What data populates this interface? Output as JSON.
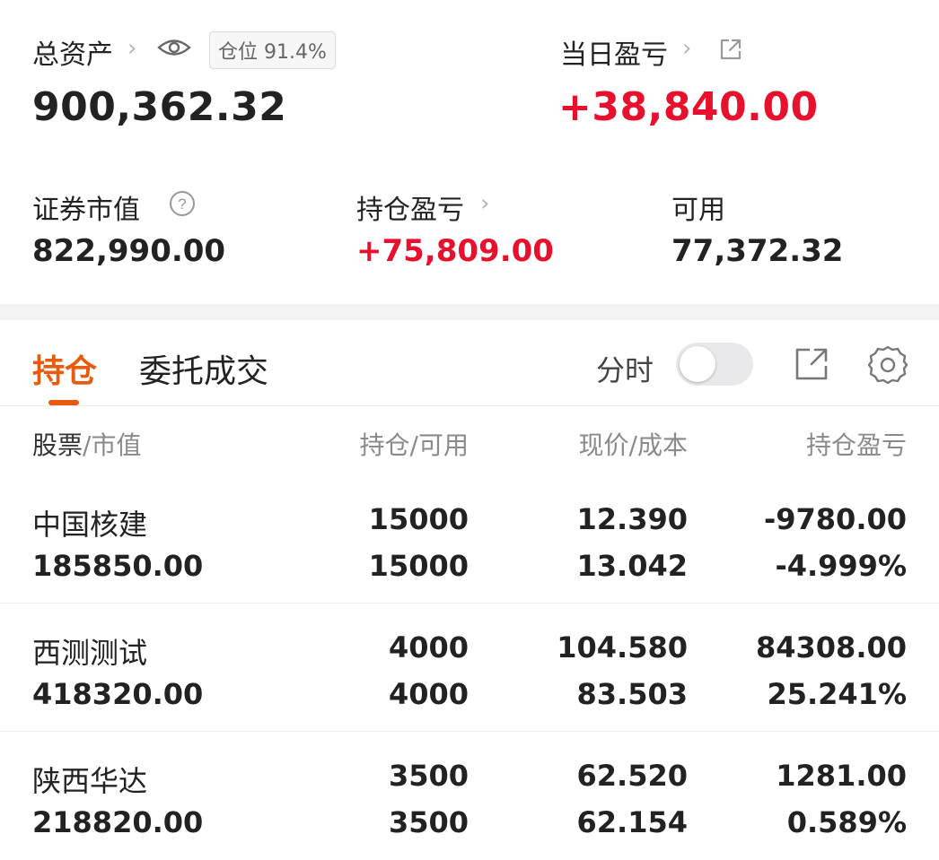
{
  "summary": {
    "total_assets_label": "总资产",
    "position_badge": "仓位 91.4%",
    "total_assets_value": "900,362.32",
    "daily_pnl_label": "当日盈亏",
    "daily_pnl_value": "+38,840.00",
    "market_value_label": "证券市值",
    "market_value": "822,990.00",
    "holding_pnl_label": "持仓盈亏",
    "holding_pnl_value": "+75,809.00",
    "available_label": "可用",
    "available_value": "77,372.32"
  },
  "tabs": [
    "持仓",
    "委托成交"
  ],
  "timeshare_label": "分时",
  "timeshare_on": false,
  "table_header": {
    "stock": "股票",
    "market_value": "市值",
    "holding": "持仓",
    "available": "可用",
    "price": "现价",
    "cost": "成本",
    "pnl": "持仓盈亏",
    "sep": "/"
  },
  "rows": [
    {
      "name": "中国核建",
      "market_value": "185850.00",
      "holding": "15000",
      "available": "15000",
      "price": "12.390",
      "cost": "13.042",
      "pnl": "-9780.00",
      "pnl_pct": "-4.999%",
      "direction": "down"
    },
    {
      "name": "西测测试",
      "market_value": "418320.00",
      "holding": "4000",
      "available": "4000",
      "price": "104.580",
      "cost": "83.503",
      "pnl": "84308.00",
      "pnl_pct": "25.241%",
      "direction": "up"
    },
    {
      "name": "陕西华达",
      "market_value": "218820.00",
      "holding": "3500",
      "available": "3500",
      "price": "62.520",
      "cost": "62.154",
      "pnl": "1281.00",
      "pnl_pct": "0.589%",
      "direction": "up"
    }
  ],
  "colors": {
    "up": "#e8112d",
    "down": "#4aa035",
    "accent": "#e85b0d"
  }
}
